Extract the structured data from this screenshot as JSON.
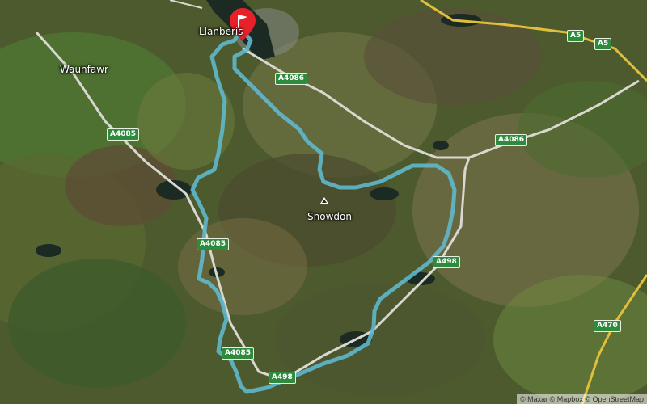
{
  "map": {
    "places": [
      {
        "id": "llanberis",
        "label": "Llanberis"
      },
      {
        "id": "waunfawr",
        "label": "Waunfawr"
      },
      {
        "id": "snowdon",
        "label": "Snowdon"
      }
    ],
    "roads": [
      {
        "id": "a5-1",
        "label": "A5"
      },
      {
        "id": "a5-2",
        "label": "A5"
      },
      {
        "id": "a4086-1",
        "label": "A4086"
      },
      {
        "id": "a4086-2",
        "label": "A4086"
      },
      {
        "id": "a4085-1",
        "label": "A4085"
      },
      {
        "id": "a4085-2",
        "label": "A4085"
      },
      {
        "id": "a4085-3",
        "label": "A4085"
      },
      {
        "id": "a498-1",
        "label": "A498"
      },
      {
        "id": "a498-2",
        "label": "A498"
      },
      {
        "id": "a470-1",
        "label": "A470"
      }
    ],
    "route_color": "#5fb8cc",
    "marker_color": "#e8202a",
    "attribution": "© Maxar © Mapbox © OpenStreetMap"
  }
}
